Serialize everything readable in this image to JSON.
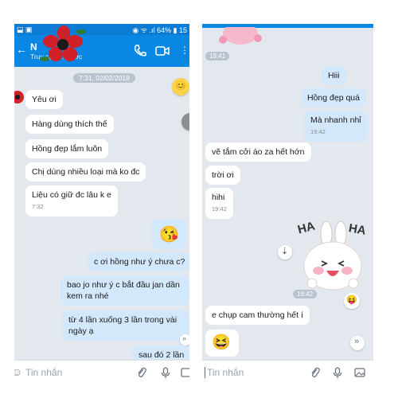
{
  "left": {
    "status_bar": {
      "battery": "64%",
      "time": "15"
    },
    "header": {
      "contact_name": "N",
      "subtitle": "Truy cập ... trước"
    },
    "date_chip": "7:31, 02/02/2019",
    "messages": [
      {
        "dir": "received",
        "text": "Yêu ơi"
      },
      {
        "dir": "received",
        "text": "Hàng dùng thích thế"
      },
      {
        "dir": "received",
        "text": "Hồng đẹp lắm luôn"
      },
      {
        "dir": "received",
        "text": "Chị dùng nhiều loại mà ko đc"
      },
      {
        "dir": "received",
        "text": "Liệu có giữ đc lâu k e",
        "time": "7:32"
      },
      {
        "dir": "sent",
        "text": "c ơi hồng như ý chưa c?"
      },
      {
        "dir": "sent",
        "text": "bao jo như ý c bắt đầu jan dần kem ra nhé"
      },
      {
        "dir": "sent",
        "text": "từ 4 lần xuống 3 lần trong vài ngày ạ"
      },
      {
        "dir": "sent",
        "text": "sau đó 2 lần"
      }
    ],
    "input_placeholder": "Tin nhắn"
  },
  "right": {
    "top_time": "19:41",
    "messages": [
      {
        "dir": "sent",
        "text": "Hiii"
      },
      {
        "dir": "sent",
        "text": "Hồng đẹp quá"
      },
      {
        "dir": "sent",
        "text": "Mà nhanh nhỉ",
        "time": "19:42"
      },
      {
        "dir": "received",
        "text": "vẽ tắm cởi áo za hết hớn"
      },
      {
        "dir": "received",
        "text": "trời ơi"
      },
      {
        "dir": "received",
        "text": "hihi",
        "time": "19:42"
      },
      {
        "dir": "received",
        "text": "e chụp cam thường hết í"
      }
    ],
    "sticker_text": [
      "HA",
      "HA"
    ],
    "sticker_time": "19:42",
    "input_placeholder": "Tin nhắn"
  },
  "colors": {
    "header_blue": "#0a86e3",
    "sent_bubble": "#d4e8fb",
    "received_bubble": "#ffffff",
    "chat_bg": "#e3e8ef"
  }
}
